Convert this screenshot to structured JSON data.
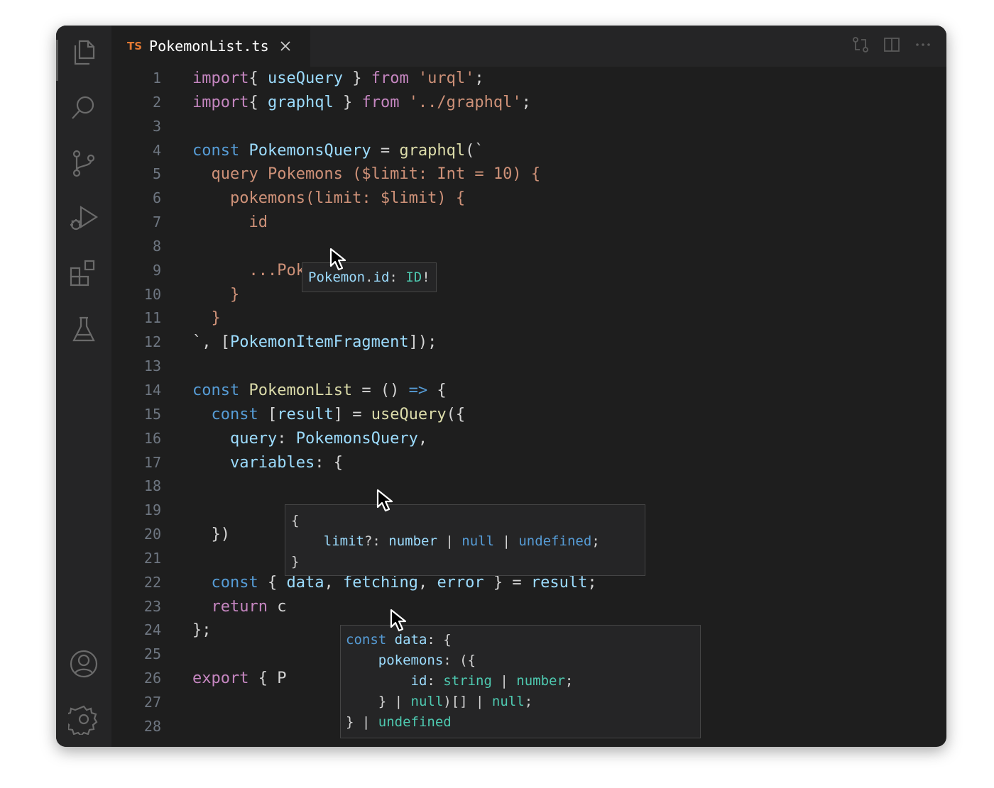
{
  "tab": {
    "lang_badge": "TS",
    "filename": "PokemonList.ts"
  },
  "activity_bar": [
    "files-icon",
    "search-icon",
    "source-control-icon",
    "run-debug-icon",
    "extensions-icon",
    "testing-icon",
    "account-icon",
    "settings-gear-icon"
  ],
  "editor_actions": [
    "open-changes-icon",
    "split-editor-icon",
    "more-actions-icon"
  ],
  "line_numbers": [
    "1",
    "2",
    "3",
    "4",
    "5",
    "6",
    "7",
    "8",
    "9",
    "10",
    "11",
    "12",
    "13",
    "14",
    "15",
    "16",
    "17",
    "18",
    "19",
    "20",
    "21",
    "22",
    "23",
    "24",
    "25",
    "26",
    "27",
    "28"
  ],
  "code_lines": [
    [
      [
        "kw2",
        "import"
      ],
      [
        "",
        "{ "
      ],
      [
        "id",
        "useQuery"
      ],
      [
        "",
        " } "
      ],
      [
        "kw2",
        "from"
      ],
      [
        "",
        " "
      ],
      [
        "str",
        "'urql'"
      ],
      [
        "",
        ";"
      ]
    ],
    [
      [
        "kw2",
        "import"
      ],
      [
        "",
        "{ "
      ],
      [
        "id",
        "graphql"
      ],
      [
        "",
        " } "
      ],
      [
        "kw2",
        "from"
      ],
      [
        "",
        " "
      ],
      [
        "str",
        "'../graphql'"
      ],
      [
        "",
        ";"
      ]
    ],
    [],
    [
      [
        "kw",
        "const"
      ],
      [
        "",
        " "
      ],
      [
        "id",
        "PokemonsQuery"
      ],
      [
        "",
        " = "
      ],
      [
        "fn",
        "graphql"
      ],
      [
        "",
        "(`"
      ]
    ],
    [
      [
        "gql",
        "  query Pokemons ($limit: Int = 10) {"
      ]
    ],
    [
      [
        "gql",
        "    pokemons(limit: $limit) {"
      ]
    ],
    [
      [
        "gql",
        "      id"
      ]
    ],
    [],
    [
      [
        "gql",
        "      ...PokemonItem"
      ]
    ],
    [
      [
        "gql",
        "    }"
      ]
    ],
    [
      [
        "gql",
        "  }"
      ]
    ],
    [
      [
        "",
        "`, ["
      ],
      [
        "id",
        "PokemonItemFragment"
      ],
      [
        "",
        "]);"
      ]
    ],
    [],
    [
      [
        "kw",
        "const"
      ],
      [
        "",
        " "
      ],
      [
        "fn",
        "PokemonList"
      ],
      [
        "",
        " = () "
      ],
      [
        "kw",
        "=>"
      ],
      [
        "",
        " {"
      ]
    ],
    [
      [
        "",
        "  "
      ],
      [
        "kw",
        "const"
      ],
      [
        "",
        " ["
      ],
      [
        "id",
        "result"
      ],
      [
        "",
        "] = "
      ],
      [
        "fn",
        "useQuery"
      ],
      [
        "",
        "({"
      ]
    ],
    [
      [
        "",
        "    "
      ],
      [
        "id",
        "query"
      ],
      [
        "",
        ": "
      ],
      [
        "id",
        "PokemonsQuery"
      ],
      [
        "",
        ","
      ]
    ],
    [
      [
        "",
        "    "
      ],
      [
        "id",
        "variables"
      ],
      [
        "",
        ": {"
      ]
    ],
    [],
    [],
    [
      [
        "",
        "  })"
      ]
    ],
    [],
    [
      [
        "",
        "  "
      ],
      [
        "kw",
        "const"
      ],
      [
        "",
        " { "
      ],
      [
        "id",
        "data"
      ],
      [
        "",
        ", "
      ],
      [
        "id",
        "fetching"
      ],
      [
        "",
        ", "
      ],
      [
        "id",
        "error"
      ],
      [
        "",
        " } = "
      ],
      [
        "id",
        "result"
      ],
      [
        "",
        ";"
      ]
    ],
    [
      [
        "",
        "  "
      ],
      [
        "kw2",
        "return"
      ],
      [
        "",
        " c"
      ]
    ],
    [
      [
        "",
        "};"
      ]
    ],
    [],
    [
      [
        "kw2",
        "export"
      ],
      [
        "",
        " { P"
      ]
    ],
    [],
    []
  ],
  "hover_id": [
    [
      [
        "id",
        "Pokemon"
      ],
      [
        "",
        "."
      ],
      [
        "id",
        "id"
      ],
      [
        "",
        ": "
      ],
      [
        "ty",
        "ID"
      ],
      [
        "",
        "!"
      ]
    ]
  ],
  "hover_variables": [
    [
      [
        "",
        "{"
      ]
    ],
    [
      [
        "",
        "    "
      ],
      [
        "id",
        "limit"
      ],
      [
        "",
        "?: "
      ],
      [
        "id",
        "number"
      ],
      [
        "",
        " | "
      ],
      [
        "kw",
        "null"
      ],
      [
        "",
        " | "
      ],
      [
        "kw",
        "undefined"
      ],
      [
        "",
        ";"
      ]
    ],
    [
      [
        "",
        "}"
      ]
    ]
  ],
  "hover_data": [
    [
      [
        "kw",
        "const"
      ],
      [
        "",
        " "
      ],
      [
        "id",
        "data"
      ],
      [
        "",
        ": {"
      ]
    ],
    [
      [
        "",
        "    "
      ],
      [
        "id",
        "pokemons"
      ],
      [
        "",
        ": ({"
      ]
    ],
    [
      [
        "",
        "        "
      ],
      [
        "id",
        "id"
      ],
      [
        "",
        ": "
      ],
      [
        "ty",
        "string"
      ],
      [
        "",
        " | "
      ],
      [
        "ty",
        "number"
      ],
      [
        "",
        ";"
      ]
    ],
    [
      [
        "",
        "    } | "
      ],
      [
        "ty",
        "null"
      ],
      [
        "",
        ")[] | "
      ],
      [
        "ty",
        "null"
      ],
      [
        "",
        ";"
      ]
    ],
    [
      [
        "",
        "} | "
      ],
      [
        "ty",
        "undefined"
      ]
    ]
  ]
}
